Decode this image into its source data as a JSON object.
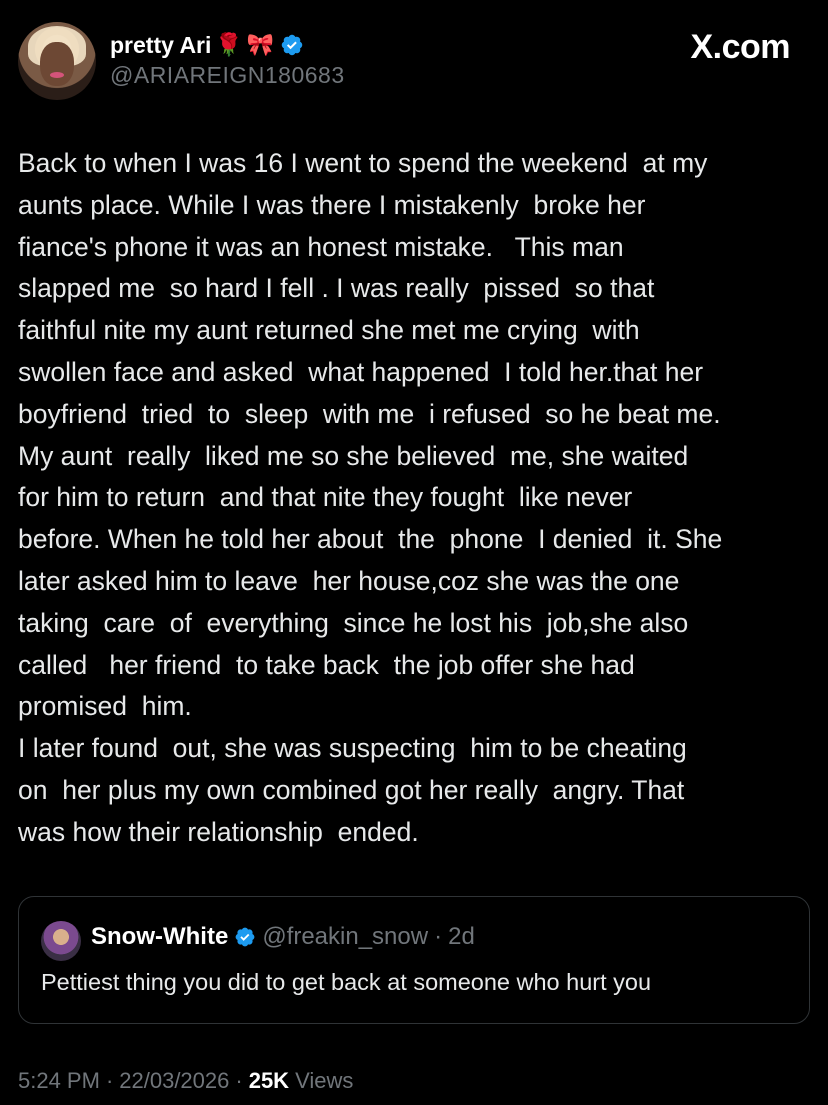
{
  "author": {
    "display_name": "pretty Ari",
    "emojis": [
      "🌹",
      "🎀"
    ],
    "handle": "@ARIAREIGN180683",
    "avatar_icon": "profile-photo"
  },
  "brand": {
    "label": "X.com"
  },
  "tweet": {
    "lines": [
      "Back to when I was 16 I went to spend the weekend  at my",
      "aunts place. While I was there I mistakenly  broke her",
      "fiance's phone it was an honest mistake.   This man",
      "slapped me  so hard I fell . I was really  pissed  so that",
      "faithful nite my aunt returned she met me crying  with",
      "swollen face and asked  what happened  I told her.that her",
      "boyfriend  tried  to  sleep  with me  i refused  so he beat me.",
      "My aunt  really  liked me so she believed  me, she waited",
      "for him to return  and that nite they fought  like never",
      "before. When he told her about  the  phone  I denied  it. She",
      "later asked him to leave  her house,coz she was the one",
      "taking  care  of  everything  since he lost his  job,she also",
      "called   her friend  to take back  the job offer she had",
      "promised  him.",
      "I later found  out, she was suspecting  him to be cheating",
      "on  her plus my own combined got her really  angry. That",
      "was how their relationship  ended."
    ]
  },
  "quote": {
    "name": "Snow-White",
    "handle": "@freakin_snow",
    "separator": "·",
    "age": "2d",
    "text": "Pettiest thing you did to get back at someone who hurt you"
  },
  "meta": {
    "time": "5:24 PM",
    "sep1": "·",
    "date": "22/03/2026",
    "sep2": "·",
    "views_count": "25K",
    "views_label": "Views"
  },
  "colors": {
    "background": "#000000",
    "text": "#e7e9ea",
    "muted": "#71767b",
    "verified": "#1d9bf0",
    "border": "#2f3336"
  }
}
